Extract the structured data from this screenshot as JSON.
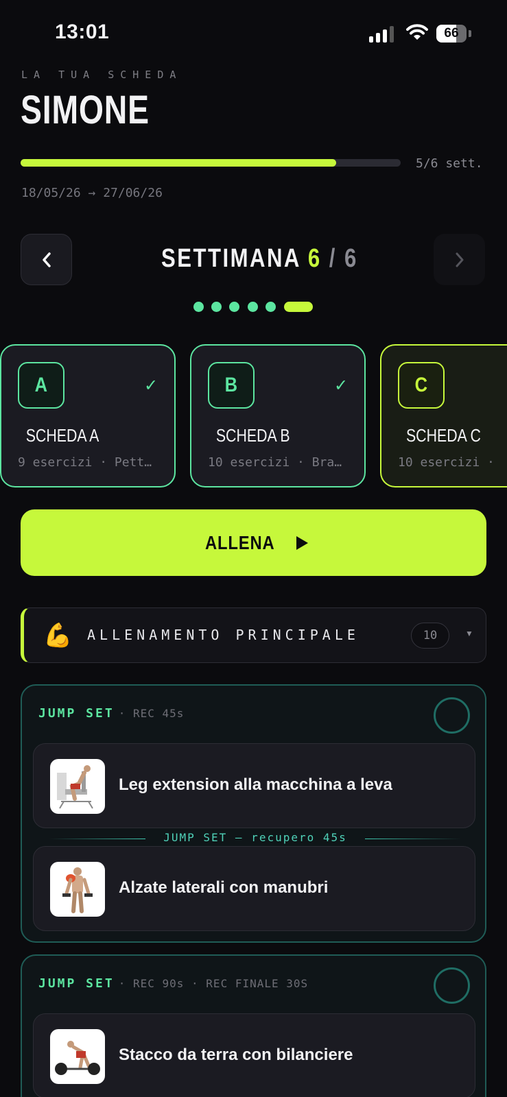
{
  "status_bar": {
    "time": "13:01",
    "battery": "66"
  },
  "header": {
    "eyebrow": "LA TUA SCHEDA",
    "name": "SIMONE",
    "progress_fraction": 0.83,
    "weeks_label": "5/6 sett.",
    "date_range": "18/05/26 → 27/06/26"
  },
  "week_nav": {
    "label": "SETTIMANA",
    "current": "6",
    "separator": "/",
    "total": "6",
    "dots_total": 6,
    "active_dot": 6
  },
  "workouts": [
    {
      "letter": "A",
      "title": "SCHEDA A",
      "subtitle": "9 esercizi · Pett…",
      "done": true
    },
    {
      "letter": "B",
      "title": "SCHEDA B",
      "subtitle": "10 esercizi · Bra…",
      "done": true
    },
    {
      "letter": "C",
      "title": "SCHEDA C",
      "subtitle": "10 esercizi ·",
      "done": false
    }
  ],
  "start_button": {
    "label": "ALLENA"
  },
  "section": {
    "emoji": "💪",
    "title": "ALLENAMENTO PRINCIPALE",
    "count": "10"
  },
  "groups": [
    {
      "type": "JUMP SET",
      "meta": "· REC 45s",
      "link_label": "JUMP SET — recupero 45s",
      "exercises": [
        {
          "name": "Leg extension alla macchina a leva"
        },
        {
          "name": "Alzate laterali con manubri"
        }
      ]
    },
    {
      "type": "JUMP SET",
      "meta": "· REC 90s · REC FINALE 30S",
      "exercises": [
        {
          "name": "Stacco da terra con bilanciere"
        }
      ]
    }
  ],
  "colors": {
    "accent": "#c6f83b",
    "mint": "#5ce5a0",
    "teal_border": "#1f5c56",
    "background": "#0b0b0e"
  },
  "icons": [
    "chevron-left-icon",
    "chevron-right-icon",
    "check-icon",
    "play-icon",
    "caret-down-icon",
    "signal-icon",
    "wifi-icon",
    "battery-icon"
  ]
}
